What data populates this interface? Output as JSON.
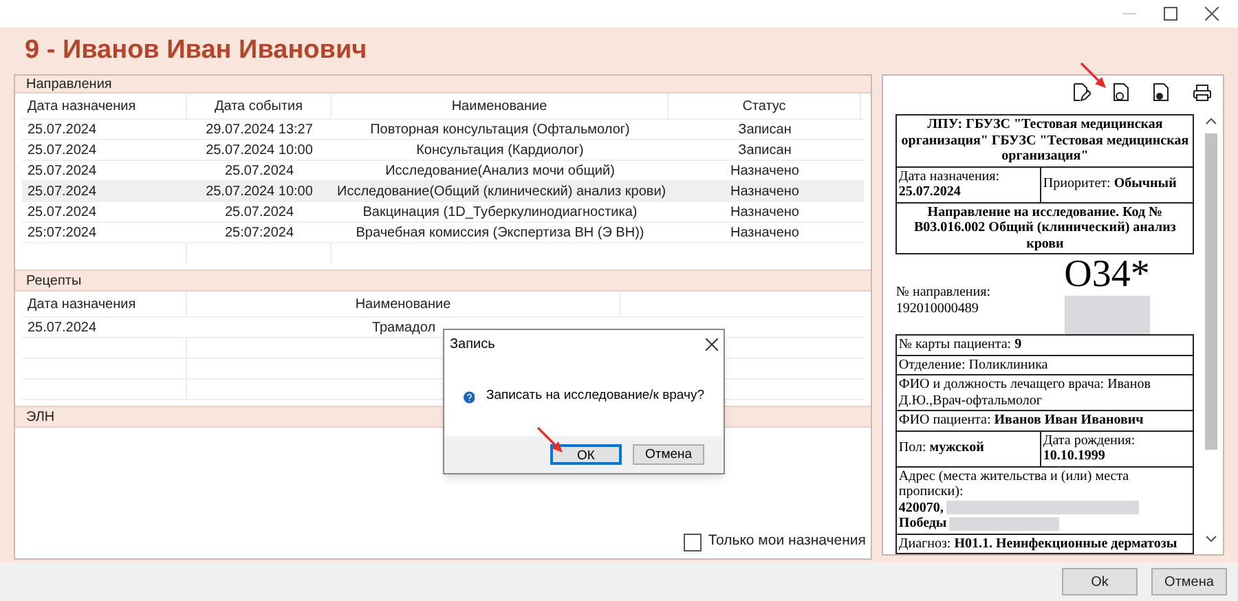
{
  "title": "9 - Иванов Иван Иванович",
  "referrals": {
    "title": "Направления",
    "columns": [
      "Дата назначения",
      "Дата события",
      "Наименование",
      "Статус"
    ],
    "rows": [
      {
        "cells": [
          "25.07.2024",
          "29.07.2024 13:27",
          "Повторная консультация (Офтальмолог)",
          "Записан"
        ],
        "selected": false
      },
      {
        "cells": [
          "25.07.2024",
          "25.07.2024 10:00",
          "Консультация (Кардиолог)",
          "Записан"
        ],
        "selected": false
      },
      {
        "cells": [
          "25.07.2024",
          "25.07.2024",
          "Исследование(Анализ мочи общий)",
          "Назначено"
        ],
        "selected": false
      },
      {
        "cells": [
          "25.07.2024",
          "25.07.2024 10:00",
          "Исследование(Общий (клинический) анализ крови)",
          "Назначено"
        ],
        "selected": true
      },
      {
        "cells": [
          "25.07.2024",
          "25.07.2024",
          "Вакцинация (1D_Туберкулинодиагностика)",
          "Назначено"
        ],
        "selected": false
      },
      {
        "cells": [
          "25:07:2024",
          "25:07:2024",
          "Врачебная комиссия (Экспертиза ВН (Э ВН))",
          "Назначено"
        ],
        "selected": false
      }
    ]
  },
  "prescriptions": {
    "title": "Рецепты",
    "columns": [
      "Дата назначения",
      "Наименование"
    ],
    "rows": [
      {
        "cells": [
          "25.07.2024",
          "Трамадол"
        ]
      }
    ]
  },
  "eln": {
    "title": "ЭЛН"
  },
  "only_mine": {
    "label": "Только мои назначения",
    "checked": false
  },
  "document": {
    "header": "ЛПУ: ГБУЗС \"Тестовая медицинская организация\" ГБУЗС \"Тестовая медицинская организация\"",
    "date": "Дата назначения: **25.07.2024**",
    "priority": "Приоритет: **Обычный**",
    "direction": "Направление на исследование. Код № B03.016.002 Общий (клинический) анализ крови",
    "number": "№ направления: 192010000489",
    "code": "О34*",
    "rows": [
      {
        "kind": "text",
        "text": "№ карты пациента: **9**"
      },
      {
        "kind": "text",
        "text": "Отделение: Поликлиника"
      },
      {
        "kind": "text",
        "text": "ФИО и должность лечащего врача: Иванов Д.Ю.,Врач-офтальмолог"
      },
      {
        "kind": "text",
        "text": "ФИО пациента: **Иванов Иван Иванович**"
      },
      {
        "kind": "pair",
        "left": "Пол: **мужской**",
        "right": "Дата рождения: **10.10.1999**"
      },
      {
        "kind": "address",
        "text": "Адрес (места жительства и (или) места прописки):",
        "parts": [
          "420070,",
          "Победы"
        ]
      },
      {
        "kind": "text",
        "text": "Диагноз: **H01.1. Неинфекционные дерматозы**"
      }
    ]
  },
  "dialog": {
    "title": "Запись",
    "message": "Записать на исследование/к врачу?",
    "buttons": [
      {
        "label": "ОК",
        "focused": true
      },
      {
        "label": "Отмена",
        "focused": false
      }
    ]
  },
  "footer_buttons": [
    "Ok",
    "Отмена"
  ]
}
